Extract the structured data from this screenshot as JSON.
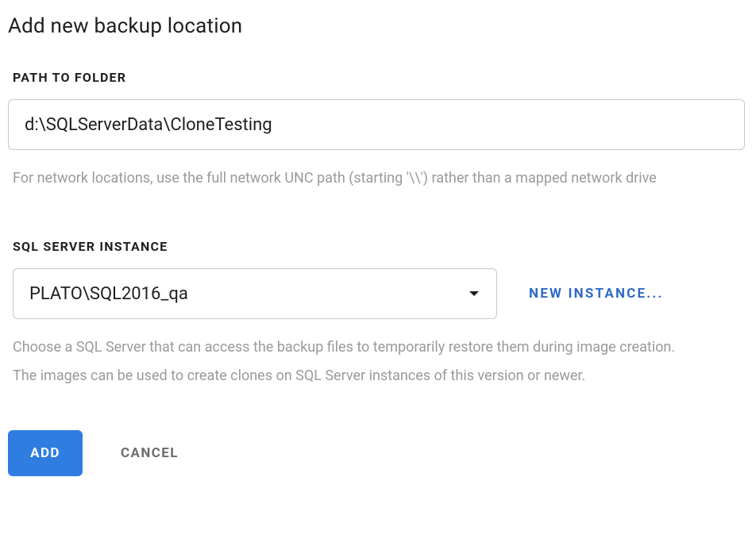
{
  "dialog": {
    "title": "Add new backup location"
  },
  "path_section": {
    "label": "PATH TO FOLDER",
    "value": "d:\\SQLServerData\\CloneTesting",
    "helper": "For network locations, use the full network UNC path (starting '\\\\') rather than a mapped network drive"
  },
  "instance_section": {
    "label": "SQL SERVER INSTANCE",
    "selected_value": "PLATO\\SQL2016_qa",
    "new_instance_label": "NEW INSTANCE...",
    "helper_line1": "Choose a SQL Server that can access the backup files to temporarily restore them during image creation.",
    "helper_line2": "The images can be used to create clones on SQL Server instances of this version or newer."
  },
  "buttons": {
    "add": "ADD",
    "cancel": "CANCEL"
  }
}
